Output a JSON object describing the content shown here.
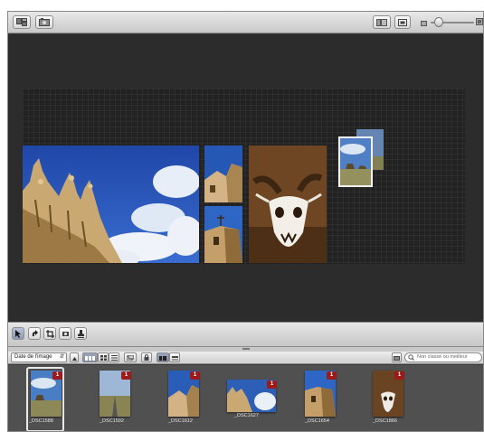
{
  "toolbar": {
    "left_buttons": [
      "layout-tools-icon",
      "photo-tools-icon"
    ],
    "right_buttons": [
      "view-mode-icon",
      "fit-icon"
    ],
    "zoom": {
      "level": 0.12,
      "small_icon": "small-photo-icon",
      "large_icon": "large-photo-icon"
    }
  },
  "tools": [
    "arrow-tool-icon",
    "rotate-tool-icon",
    "crop-tool-icon",
    "straighten-tool-icon",
    "stamp-tool-icon"
  ],
  "browser": {
    "sort_label": "Date de l'image",
    "filter_placeholder": "Non classé ou meilleur"
  },
  "thumbnails": [
    {
      "name": "_DSC1588",
      "badge": "1",
      "selected": true
    },
    {
      "name": "_DSC1592",
      "badge": "1",
      "selected": false
    },
    {
      "name": "_DSC1612",
      "badge": "1",
      "selected": false
    },
    {
      "name": "_DSC1627",
      "badge": "1",
      "selected": false
    },
    {
      "name": "_DSC1654",
      "badge": "1",
      "selected": false
    },
    {
      "name": "_DSC1866",
      "badge": "1",
      "selected": false
    }
  ],
  "colors": {
    "badge": "#9b1b1b",
    "canvas": "#2c2c2c",
    "filmstrip": "#505050"
  }
}
